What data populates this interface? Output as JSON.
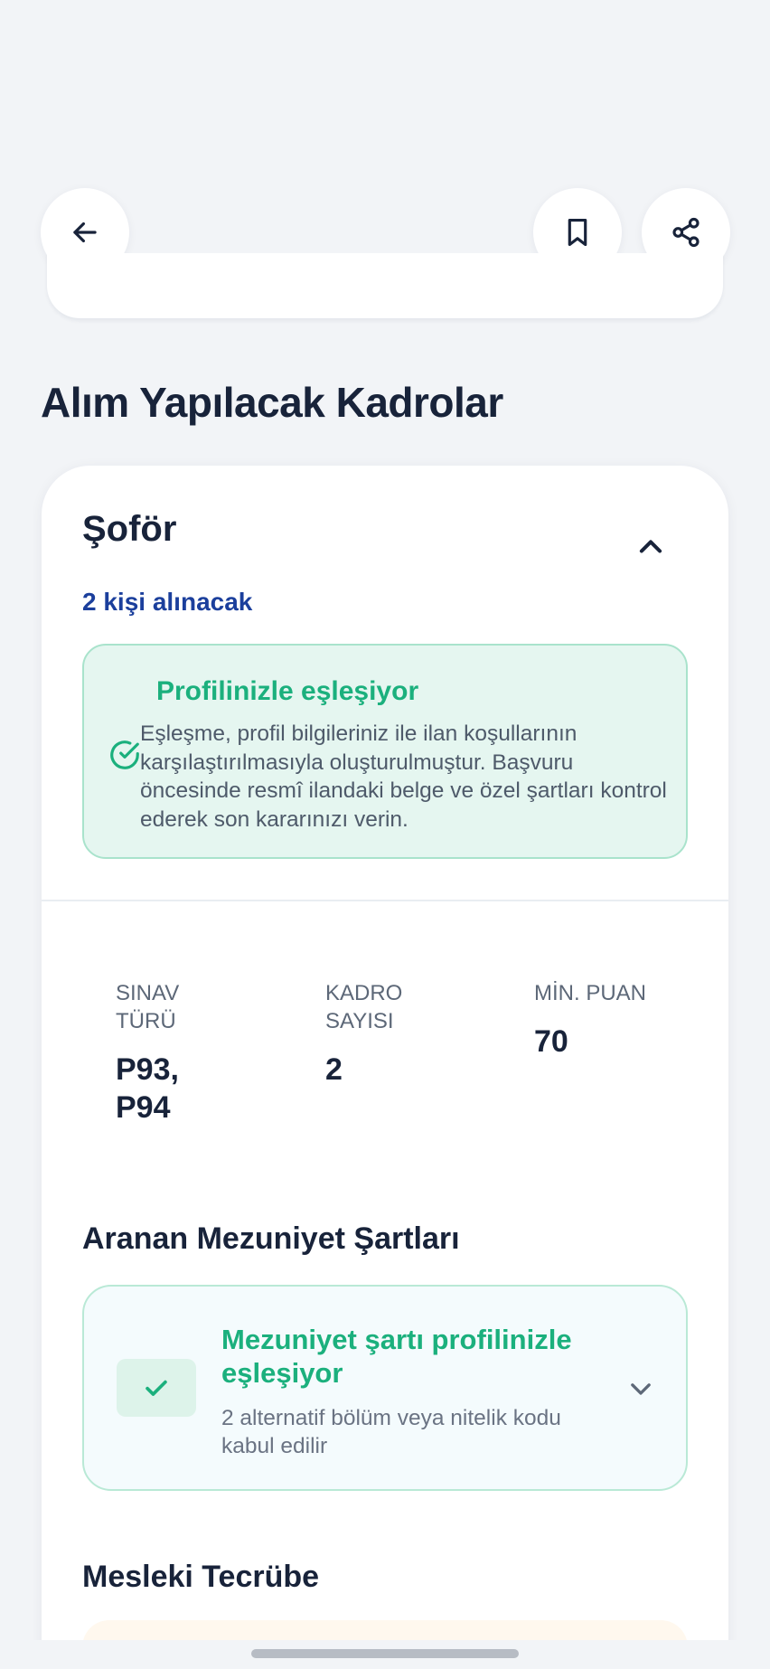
{
  "header": {
    "back_icon": "arrow-left-icon",
    "bookmark_icon": "bookmark-icon",
    "share_icon": "share-icon"
  },
  "section": {
    "title": "Alım Yapılacak Kadrolar"
  },
  "position_card": {
    "title": "Şoför",
    "toggle_icon": "chevron-up-icon",
    "positions_text": "2 kişi alınacak",
    "match": {
      "title": "Profilinizle eşleşiyor",
      "icon": "check-circle-icon",
      "description": "Eşleşme, profil bilgileriniz ile ilan koşullarının karşılaştırılmasıyla oluşturulmuştur. Başvuru öncesinde resmî ilandaki belge ve özel şartları kontrol ederek son kararınızı verin.",
      "accent_color": "#1bb07d"
    },
    "stats": [
      {
        "label": "SINAV TÜRÜ",
        "value": "P93, P94"
      },
      {
        "label": "KADRO SAYISI",
        "value": "2"
      },
      {
        "label": "MİN. PUAN",
        "value": "70"
      }
    ],
    "graduation": {
      "heading": "Aranan Mezuniyet Şartları",
      "status_title": "Mezuniyet şartı profilinizle eşleşiyor",
      "status_subtitle": "2 alternatif bölüm veya nitelik kodu kabul edilir",
      "check_icon": "check-icon",
      "expand_icon": "chevron-down-icon"
    },
    "experience": {
      "heading": "Mesleki Tecrübe"
    }
  },
  "colors": {
    "background": "#f2f4f7",
    "primary_text": "#18233a",
    "link_blue": "#1b3f9c",
    "success_green": "#1bb07d"
  }
}
